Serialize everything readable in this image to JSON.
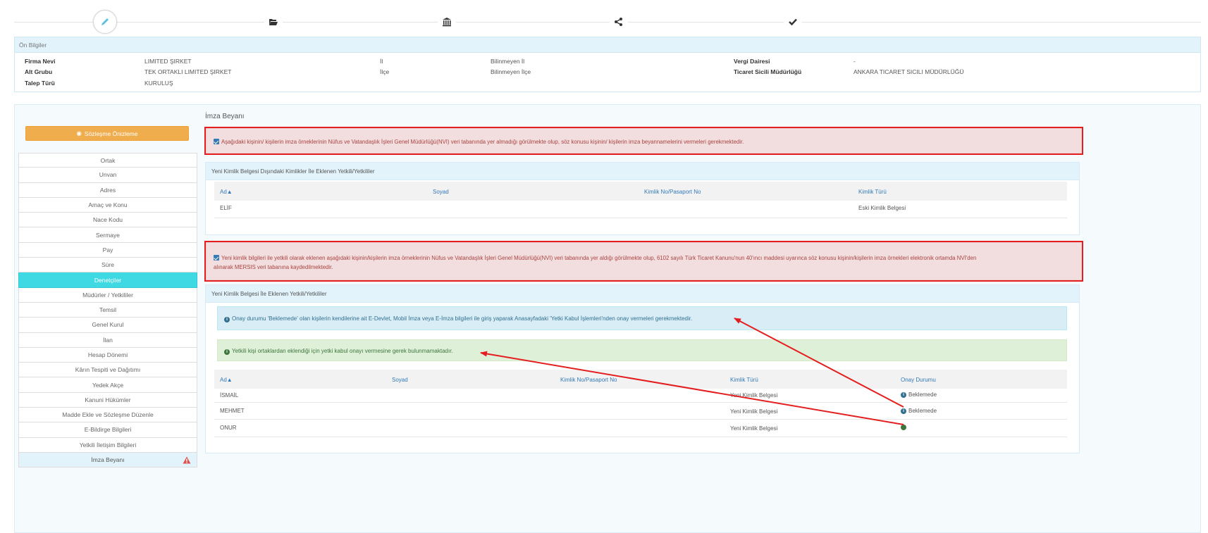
{
  "wizard": {
    "steps": [
      {
        "icon": "pencil-icon",
        "active": true
      },
      {
        "icon": "folder-open-icon",
        "active": false
      },
      {
        "icon": "bank-icon",
        "active": false
      },
      {
        "icon": "share-icon",
        "active": false
      },
      {
        "icon": "check-icon",
        "active": false
      }
    ]
  },
  "on_bilgiler": {
    "title": "Ön Bilgiler",
    "firma_nevi_label": "Firma Nevi",
    "firma_nevi_value": "LIMITED ŞIRKET",
    "alt_grubu_label": "Alt Grubu",
    "alt_grubu_value": "TEK ORTAKLI LIMITED ŞIRKET",
    "talep_turu_label": "Talep Türü",
    "talep_turu_value": "KURULUŞ",
    "il_label": "İl",
    "il_value": "Bilinmeyen İl",
    "ilce_label": "İlçe",
    "ilce_value": "Bilinmeyen İlçe",
    "vergi_dairesi_label": "Vergi Dairesi",
    "vergi_dairesi_value": "-",
    "ticaret_sicil_label": "Ticaret Sicili Müdürlüğü",
    "ticaret_sicil_value": "ANKARA TICARET SICILI MÜDÜRLÜĞÜ"
  },
  "sidebar": {
    "preview_button": "Sözleşme Önizleme",
    "items": [
      {
        "label": "Ortak"
      },
      {
        "label": "Unvan"
      },
      {
        "label": "Adres"
      },
      {
        "label": "Amaç ve Konu"
      },
      {
        "label": "Nace Kodu"
      },
      {
        "label": "Sermaye"
      },
      {
        "label": "Pay"
      },
      {
        "label": "Süre"
      },
      {
        "label": "Denetçiler"
      },
      {
        "label": "Müdürler / Yetkililer"
      },
      {
        "label": "Temsil"
      },
      {
        "label": "Genel Kurul"
      },
      {
        "label": "İlan"
      },
      {
        "label": "Hesap Dönemi"
      },
      {
        "label": "Kârın Tespiti ve Dağıtımı"
      },
      {
        "label": "Yedek Akçe"
      },
      {
        "label": "Kanuni Hükümler"
      },
      {
        "label": "Madde Ekle ve Sözleşme Düzenle"
      },
      {
        "label": "E-Bildirge Bilgileri"
      },
      {
        "label": "Yetkili İletişim Bilgileri"
      },
      {
        "label": "İmza Beyanı"
      }
    ]
  },
  "main": {
    "section_title": "İmza Beyanı",
    "alert1": "Aşağıdaki kişinin/ kişilerin imza örneklerinin Nüfus ve Vatandaşlık İşleri Genel Müdürlüğü(NVI) veri tabanında yer almadığı görülmekte olup, söz konusu kişinin/ kişilerin imza beyannamelerini vermeleri gerekmektedir.",
    "panel1": {
      "title": "Yeni Kimlik Belgesi Dışındaki Kimlikler İle Eklenen Yetkili/Yetkililer",
      "columns": [
        "Ad▲",
        "Soyad",
        "Kimlik No/Pasaport No",
        "Kimlik Türü"
      ],
      "rows": [
        {
          "ad": "ELİF",
          "soyad": "",
          "kimlik_no": "",
          "kimlik_turu": "Eski Kimlik Belgesi"
        }
      ]
    },
    "alert2_line1": "Yeni kimlik bilgileri ile yetkili olarak eklenen aşağıdaki kişinin/kişilerin imza örneklerinin Nüfus ve Vatandaşlık İşleri Genel Müdürlüğü(NVI) veri tabanında yer aldığı görülmekte olup, 6102 sayılı Türk Ticaret Kanunu'nun 40'ıncı maddesi uyarınca söz konusu kişinin/kişilerin imza örnekleri elektronik ortamda NVİ'den",
    "alert2_line2": "alınarak MERSIS veri tabanına kaydedilmektedir.",
    "panel2": {
      "title": "Yeni Kimlik Belgesi İle Eklenen Yetkili/Yetkililer",
      "info_alert": "Onay durumu 'Beklemede' olan kişilerin kendilerine ait E-Devlet, Mobil İmza veya E-İmza bilgileri ile giriş yaparak Anasayfadaki 'Yetki Kabul İşlemleri'nden onay vermeleri gerekmektedir.",
      "success_alert": "Yetkili kişi ortaklardan eklendiği için yetki kabul onayı vermesine gerek bulunmamaktadır.",
      "columns": [
        "Ad▲",
        "Soyad",
        "Kimlik No/Pasaport No",
        "Kimlik Türü",
        "Onay Durumu"
      ],
      "rows": [
        {
          "ad": "İSMAİL",
          "kimlik_turu": "Yeni Kimlik Belgesi",
          "onay": "Beklemede"
        },
        {
          "ad": "MEHMET",
          "kimlik_turu": "Yeni Kimlik Belgesi",
          "onay": "Beklemede"
        },
        {
          "ad": "ONUR",
          "kimlik_turu": "Yeni Kimlik Belgesi",
          "onay": ""
        }
      ]
    }
  },
  "colors": {
    "annotation_red": "#e41e1e",
    "menu_active": "#3fd9e4",
    "preview_button": "#f0ad4e",
    "header_bg": "#e2f3fb"
  }
}
